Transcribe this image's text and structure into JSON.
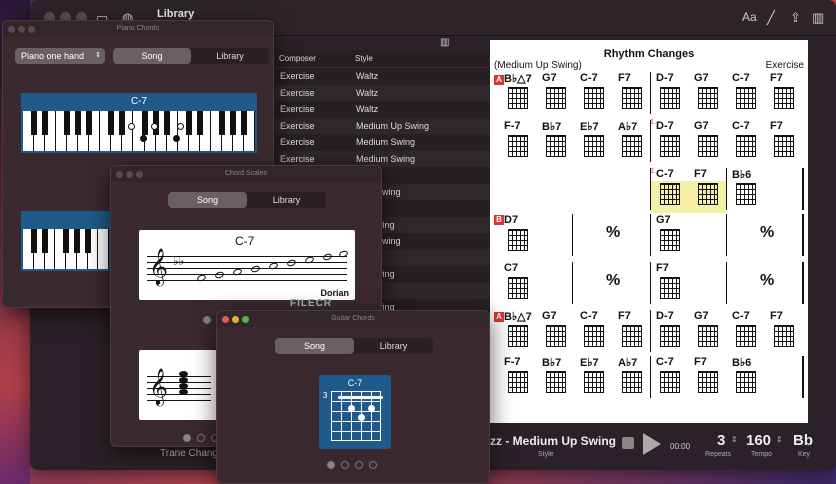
{
  "main": {
    "title": "Library",
    "toolbar_icons": [
      "Aa",
      "pencil-icon",
      "share-icon",
      "sidebar-icon"
    ],
    "list": {
      "headers": [
        "Composer",
        "Style"
      ],
      "rows": [
        [
          "Exercise",
          "Waltz"
        ],
        [
          "Exercise",
          "Waltz"
        ],
        [
          "Exercise",
          "Waltz"
        ],
        [
          "Exercise",
          "Medium Up Swing"
        ],
        [
          "Exercise",
          "Medium Swing"
        ],
        [
          "Exercise",
          "Medium Swing"
        ],
        [
          "",
          "ths"
        ],
        [
          "",
          "mpo Swing"
        ],
        [
          "",
          "ths"
        ],
        [
          "",
          "Up Swing"
        ],
        [
          "",
          "mpo Swing"
        ],
        [
          "",
          "Swing"
        ],
        [
          "",
          "Up Swing"
        ],
        [
          "",
          "ths"
        ],
        [
          "",
          "Up Swing"
        ]
      ]
    },
    "bottom_left_text": "Trane Chang"
  },
  "sheet": {
    "title": "Rhythm Changes",
    "style": "(Medium Up Swing)",
    "composer": "Exercise",
    "row1": [
      "B♭△7",
      "G7",
      "C-7",
      "F7",
      "D-7",
      "G7",
      "C-7",
      "F7"
    ],
    "row2": [
      "F-7",
      "B♭7",
      "E♭7",
      "A♭7",
      "D-7",
      "G7",
      "C-7",
      "F7"
    ],
    "row3": [
      "C-7",
      "F7",
      "B♭6"
    ],
    "row4": [
      "D7",
      "G7"
    ],
    "row5": [
      "C7",
      "F7"
    ],
    "row6": [
      "B♭△7",
      "G7",
      "C-7",
      "F7",
      "D-7",
      "G7",
      "C-7",
      "F7"
    ],
    "row7": [
      "F-7",
      "B♭7",
      "E♭7",
      "A♭7",
      "C-7",
      "F7",
      "B♭6"
    ],
    "ending1": "1.",
    "ending2": "2.",
    "section_a": "A",
    "section_b": "B",
    "simile": "%"
  },
  "transport": {
    "style_name": "zz - Medium Up Swing",
    "style_label": "Style",
    "time": "00:00",
    "repeats": "3",
    "repeats_label": "Repeats",
    "tempo": "160",
    "tempo_label": "Tempo",
    "key": "Bb",
    "key_label": "Key"
  },
  "piano_panel": {
    "title": "Piano Chords",
    "select": "Piano one hand",
    "tab_song": "Song",
    "tab_library": "Library",
    "chord": "C-7"
  },
  "scales_panel": {
    "title": "Chord Scales",
    "tab_song": "Song",
    "tab_library": "Library",
    "chord": "C-7",
    "scale_name": "Dorian"
  },
  "guitar_panel": {
    "title": "Guitar Chords",
    "tab_song": "Song",
    "tab_library": "Library",
    "chord": "C-7",
    "fret": "3"
  },
  "watermark": "FILECR"
}
